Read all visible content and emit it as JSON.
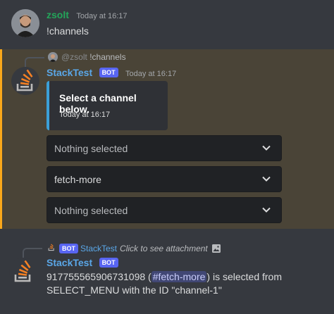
{
  "message1": {
    "username": "zsolt",
    "timestamp": "Today at 16:17",
    "content": "!channels"
  },
  "message2": {
    "reply": {
      "mention": "@zsolt",
      "content": "!channels"
    },
    "username": "StackTest",
    "bot_tag": "BOT",
    "timestamp": "Today at 16:17",
    "embed": {
      "title": "Select a channel below.",
      "footer_time": "Today at 16:17",
      "accent": "#3ba0d8"
    },
    "selects": [
      {
        "value": "Nothing selected",
        "state": "placeholder"
      },
      {
        "value": "fetch-more",
        "state": "selected"
      },
      {
        "value": "Nothing selected",
        "state": "placeholder"
      }
    ],
    "highlight_color": "#faa81a"
  },
  "message3": {
    "reply": {
      "bot_tag": "BOT",
      "username": "StackTest",
      "content": "Click to see attachment"
    },
    "username": "StackTest",
    "bot_tag": "BOT",
    "timestamp": "",
    "content_prefix": "917755565906731098 (",
    "channel_mention": "#fetch-more",
    "content_suffix": ") is selected from SELECT_MENU with the ID \"channel-1\""
  },
  "icons": {
    "chevron": "chevron-down-icon",
    "bot_avatar": "stackoverflow-logo-icon",
    "attachment": "image-icon"
  }
}
